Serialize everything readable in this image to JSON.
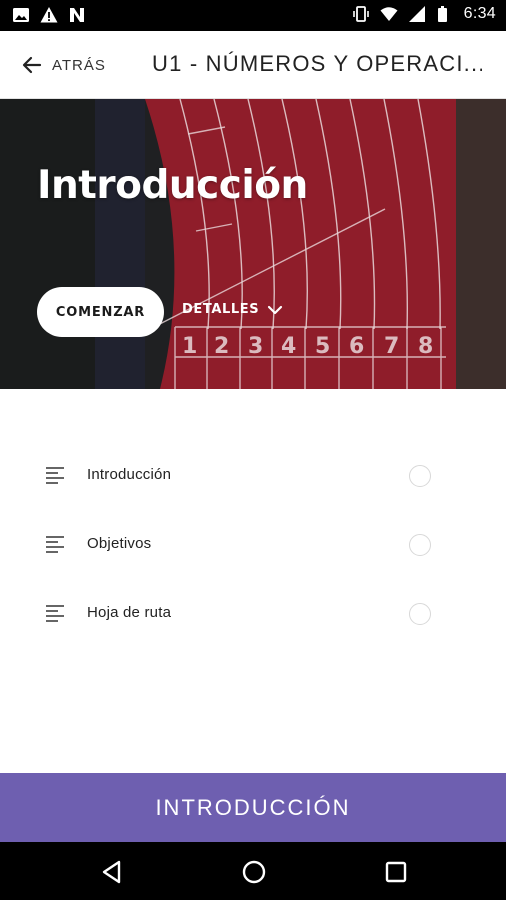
{
  "status_bar": {
    "time": "6:34",
    "left_icons": [
      "image-icon",
      "warning-icon",
      "n-icon"
    ],
    "right_icons": [
      "vibrate-icon",
      "wifi-icon",
      "signal-icon",
      "battery-icon"
    ]
  },
  "app_bar": {
    "back_label": "ATRÁS",
    "title": "U1 - NÚMEROS Y OPERACI..."
  },
  "hero": {
    "title": "Introducción",
    "start_label": "COMENZAR",
    "details_label": "DETALLES",
    "lane_numbers": [
      "1",
      "2",
      "3",
      "4",
      "5",
      "6",
      "7",
      "8"
    ]
  },
  "lessons": [
    {
      "label": "Introducción",
      "icon": "lines-icon",
      "completed": false
    },
    {
      "label": "Objetivos",
      "icon": "lines-icon",
      "completed": false
    },
    {
      "label": "Hoja de ruta",
      "icon": "lines-icon",
      "completed": false
    }
  ],
  "bottom_action": {
    "label": "INTRODUCCIÓN"
  },
  "colors": {
    "accent": "#6e5fb0",
    "track": "#8f1d2a",
    "status_bar": "#000000"
  }
}
